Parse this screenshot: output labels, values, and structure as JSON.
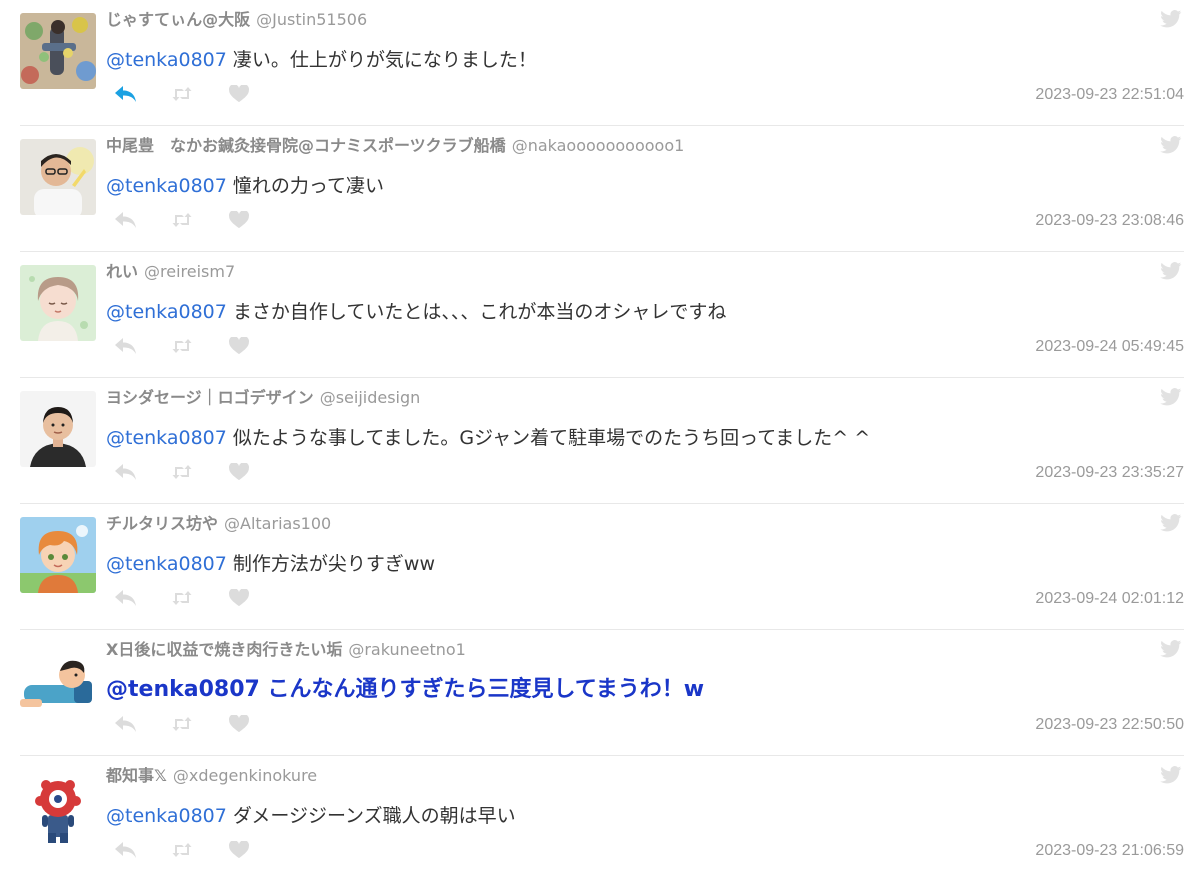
{
  "colors": {
    "mention": "#2f6fd6",
    "emphasis": "#1a36c8",
    "reply_active": "#1ba1e2",
    "icon_inactive": "#dcdcdc",
    "meta_gray": "#9a9a9a"
  },
  "tweets": [
    {
      "name": "じゃすてぃん@大阪",
      "handle": "@Justin51506",
      "mention": "@tenka0807",
      "text": " 凄い。仕上がりが気になりました！",
      "timestamp": "2023-09-23 22:51:04",
      "reply_active": true,
      "emphasis": false
    },
    {
      "name": "中尾豊　なかお鍼灸接骨院@コナミスポーツクラブ船橋",
      "handle": "@nakaooooooooooo1",
      "mention": "@tenka0807",
      "text": " 憧れの力って凄い",
      "timestamp": "2023-09-23 23:08:46",
      "reply_active": false,
      "emphasis": false
    },
    {
      "name": "れい",
      "handle": "@reireism7",
      "mention": "@tenka0807",
      "text": " まさか自作していたとは、、、これが本当のオシャレですね",
      "timestamp": "2023-09-24 05:49:45",
      "reply_active": false,
      "emphasis": false
    },
    {
      "name": "ヨシダセージ｜ロゴデザイン",
      "handle": "@seijidesign",
      "mention": "@tenka0807",
      "text": " 似たような事してました。Gジャン着て駐車場でのたうち回ってました^ ^",
      "timestamp": "2023-09-23 23:35:27",
      "reply_active": false,
      "emphasis": false
    },
    {
      "name": "チルタリス坊や",
      "handle": "@Altarias100",
      "mention": "@tenka0807",
      "text": " 制作方法が尖りすぎww",
      "timestamp": "2023-09-24 02:01:12",
      "reply_active": false,
      "emphasis": false
    },
    {
      "name": "X日後に収益で焼き肉行きたい垢",
      "handle": "@rakuneetno1",
      "mention": "@tenka0807",
      "text": " こんなん通りすぎたら三度見してまうわ！w",
      "timestamp": "2023-09-23 22:50:50",
      "reply_active": false,
      "emphasis": true
    },
    {
      "name": "都知事𝕏",
      "handle": "@xdegenkinokure",
      "mention": "@tenka0807",
      "text": " ダメージジーンズ職人の朝は早い",
      "timestamp": "2023-09-23 21:06:59",
      "reply_active": false,
      "emphasis": false
    }
  ]
}
